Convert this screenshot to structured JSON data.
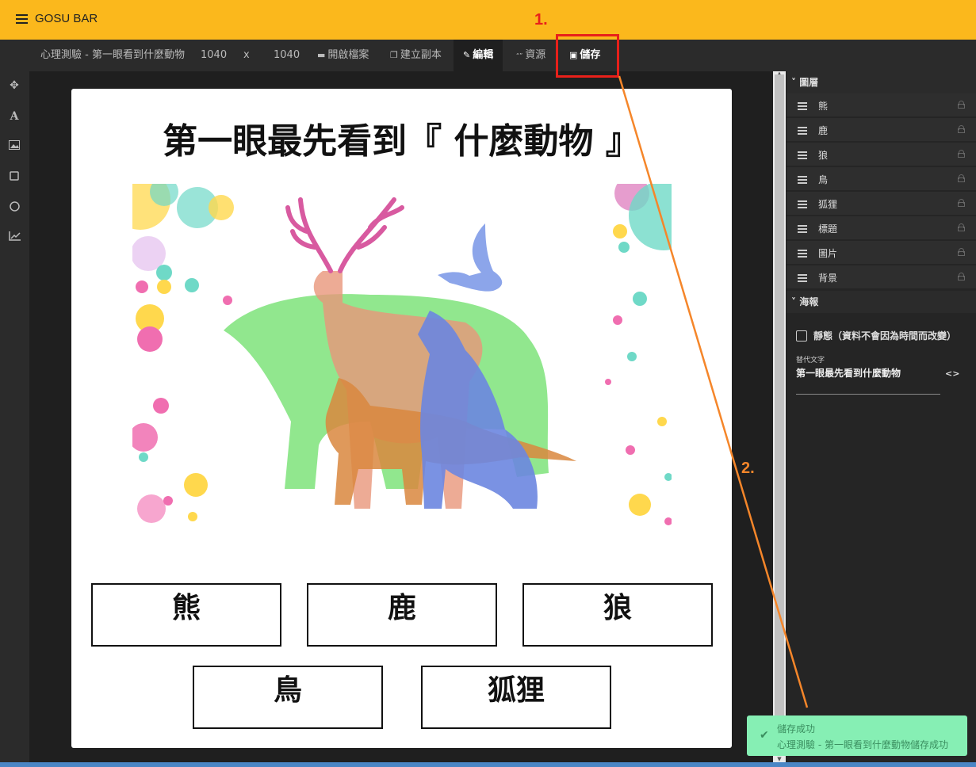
{
  "app": {
    "title": "GOSU BAR"
  },
  "toolbar": {
    "doc_name": "心理測驗 - 第一眼看到什麼動物",
    "width": "1040",
    "times": "x",
    "height": "1040",
    "open_file": "開啟檔案",
    "duplicate": "建立副本",
    "edit": "編輯",
    "resources": "資源",
    "save": "儲存"
  },
  "poster": {
    "title": "第一眼最先看到『 什麼動物 』",
    "choices": [
      "熊",
      "鹿",
      "狼",
      "鳥",
      "狐狸"
    ]
  },
  "panel": {
    "layers_header": "圖層",
    "layers": [
      "熊",
      "鹿",
      "狼",
      "鳥",
      "狐狸",
      "標題",
      "圖片",
      "背景"
    ],
    "poster_header": "海報",
    "static_label": "靜態（資料不會因為時間而改變）",
    "alt_text_label": "替代文字",
    "alt_text_value": "第一眼最先看到什麼動物"
  },
  "toast": {
    "title": "儲存成功",
    "message": "心理測驗 - 第一眼看到什麼動物儲存成功"
  },
  "annotations": {
    "step1": "1.",
    "step2": "2."
  },
  "colors": {
    "accent": "#fbb81c",
    "annotation_red": "#e8201a",
    "annotation_orange": "#f5862a",
    "toast_bg": "#86efb4"
  }
}
